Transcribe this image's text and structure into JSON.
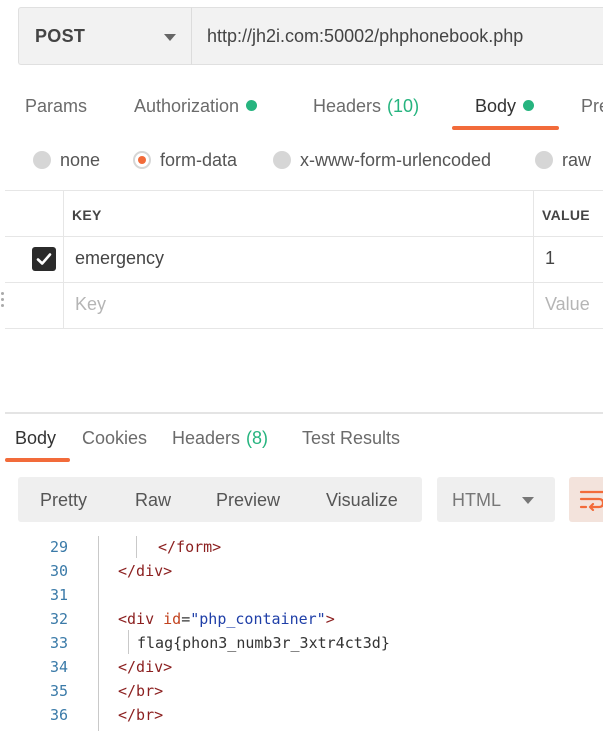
{
  "request": {
    "method": "POST",
    "url": "http://jh2i.com:50002/phphonebook.php"
  },
  "request_tabs": [
    {
      "label": "Params"
    },
    {
      "label": "Authorization",
      "indicator": "green-dot"
    },
    {
      "label": "Headers",
      "count": "(10)"
    },
    {
      "label": "Body",
      "indicator": "green-dot",
      "active": true
    },
    {
      "label": "Pre"
    }
  ],
  "body_types": [
    {
      "label": "none",
      "checked": false
    },
    {
      "label": "form-data",
      "checked": true
    },
    {
      "label": "x-www-form-urlencoded",
      "checked": false
    },
    {
      "label": "raw",
      "checked": false
    }
  ],
  "kv_table": {
    "headers": {
      "key": "KEY",
      "value": "VALUE"
    },
    "rows": [
      {
        "enabled": true,
        "key": "emergency",
        "value": "1"
      }
    ],
    "placeholder": {
      "key": "Key",
      "value": "Value"
    }
  },
  "response_tabs": [
    {
      "label": "Body",
      "active": true
    },
    {
      "label": "Cookies"
    },
    {
      "label": "Headers",
      "count": "(8)"
    },
    {
      "label": "Test Results"
    }
  ],
  "view_modes": [
    "Pretty",
    "Raw",
    "Preview",
    "Visualize"
  ],
  "language": "HTML",
  "code": {
    "line_numbers": [
      "29",
      "30",
      "31",
      "32",
      "33",
      "34",
      "35",
      "36"
    ],
    "l29": "</form>",
    "l30": "</div>",
    "l32_open": "<div ",
    "l32_attr": "id",
    "l32_eq": "=",
    "l32_val": "\"php_container\"",
    "l32_close": ">",
    "l33": "flag{phon3_numb3r_3xtr4ct3d}",
    "l34": "</div>",
    "l35": "</br>",
    "l36": "</br>"
  },
  "colors": {
    "accent": "#f26b3a",
    "status_green": "#26b47f",
    "line_number": "#3a7aa8",
    "tag": "#8b1f1f",
    "attribute": "#c2431f",
    "string": "#1f3fa8"
  }
}
